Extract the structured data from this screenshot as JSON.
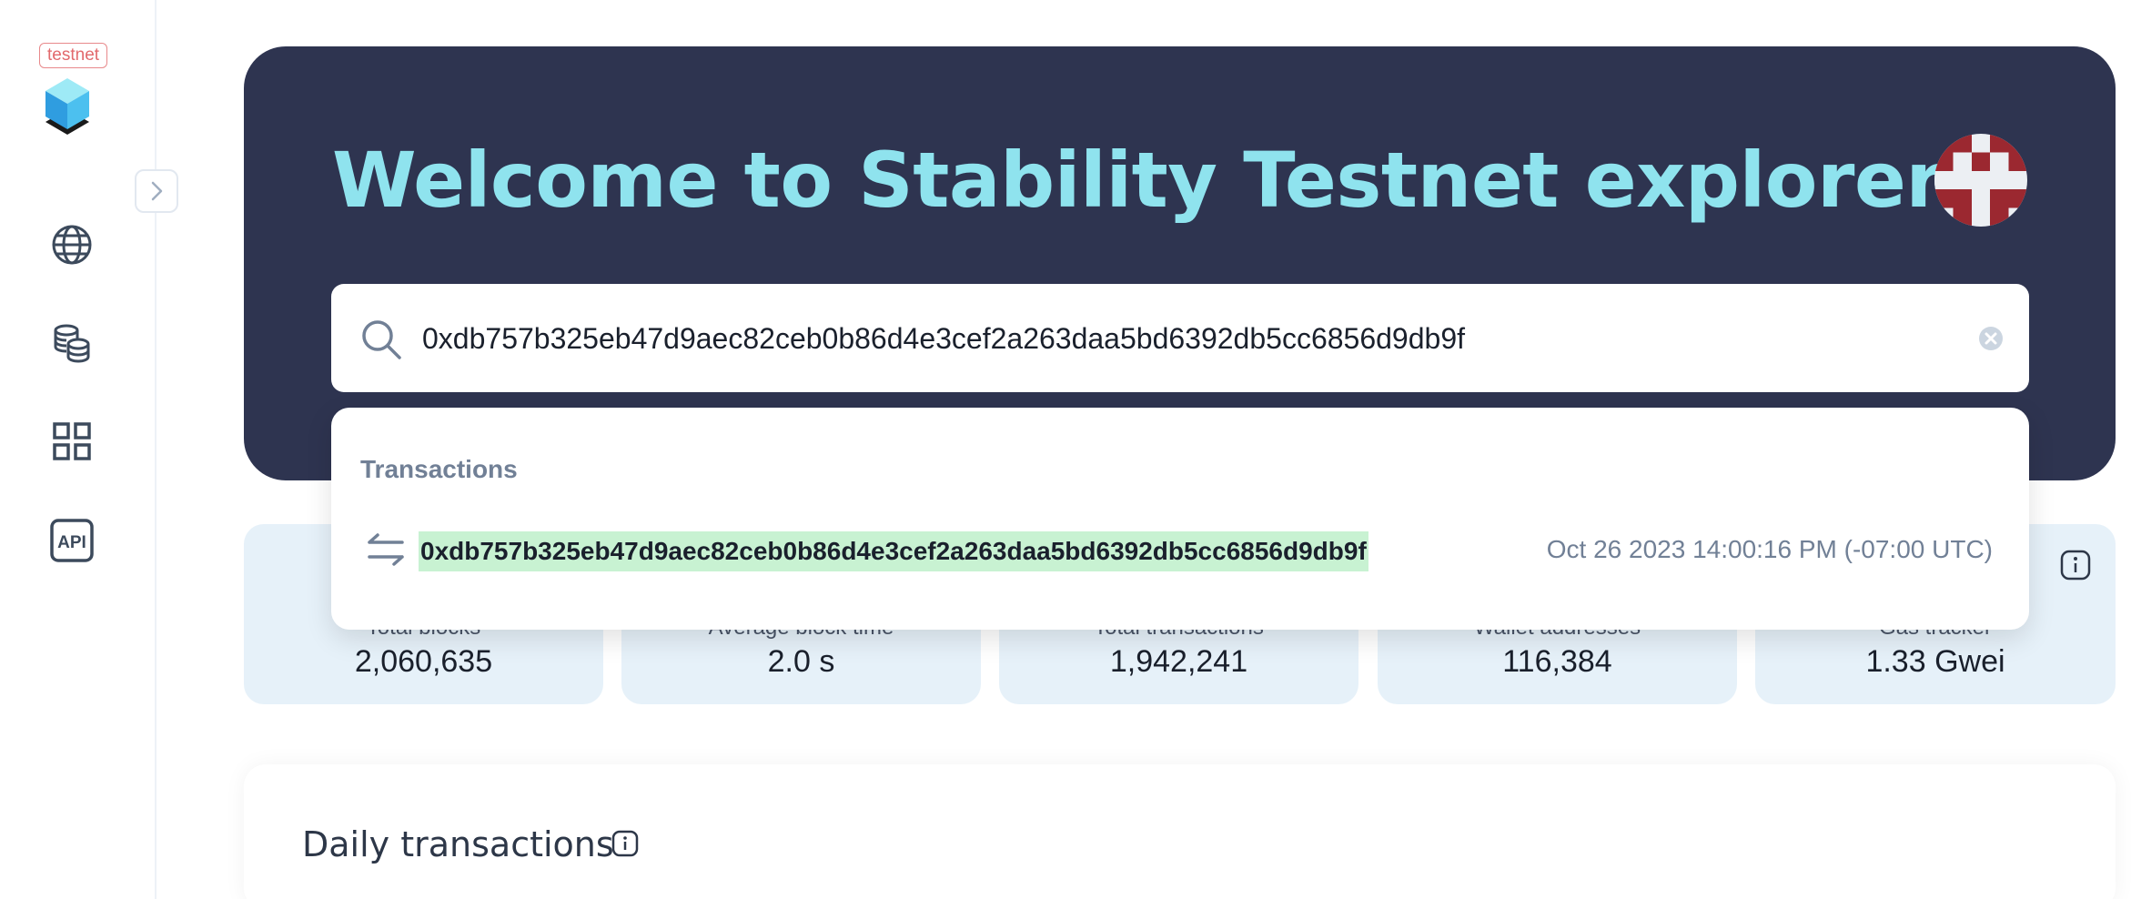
{
  "sidebar": {
    "network_tag": "testnet",
    "nav": [
      {
        "icon": "globe-icon"
      },
      {
        "icon": "coins-icon"
      },
      {
        "icon": "apps-grid-icon"
      },
      {
        "icon": "api-icon",
        "label": "API"
      }
    ]
  },
  "hero": {
    "title": "Welcome to Stability Testnet explorer"
  },
  "search": {
    "value": "0xdb757b325eb47d9aec82ceb0b86d4e3cef2a263daa5bd6392db5cc6856d9db9f"
  },
  "dropdown": {
    "section_title": "Transactions",
    "results": [
      {
        "hash": "0xdb757b325eb47d9aec82ceb0b86d4e3cef2a263daa5bd6392db5cc6856d9db9f",
        "timestamp": "Oct 26 2023 14:00:16 PM (-07:00 UTC)"
      }
    ]
  },
  "stats": [
    {
      "label": "Total blocks",
      "value": "2,060,635"
    },
    {
      "label": "Average block time",
      "value": "2.0 s"
    },
    {
      "label": "Total transactions",
      "value": "1,942,241"
    },
    {
      "label": "Wallet addresses",
      "value": "116,384"
    },
    {
      "label": "Gas tracker",
      "value": "1.33 Gwei"
    }
  ],
  "daily": {
    "title": "Daily transactions"
  },
  "colors": {
    "hero_bg": "#2e3450",
    "hero_title": "#8fe3ee",
    "stat_card_bg": "#e6f1f9",
    "highlight": "#c8f2d2",
    "network_tag": "#e26a6d"
  }
}
